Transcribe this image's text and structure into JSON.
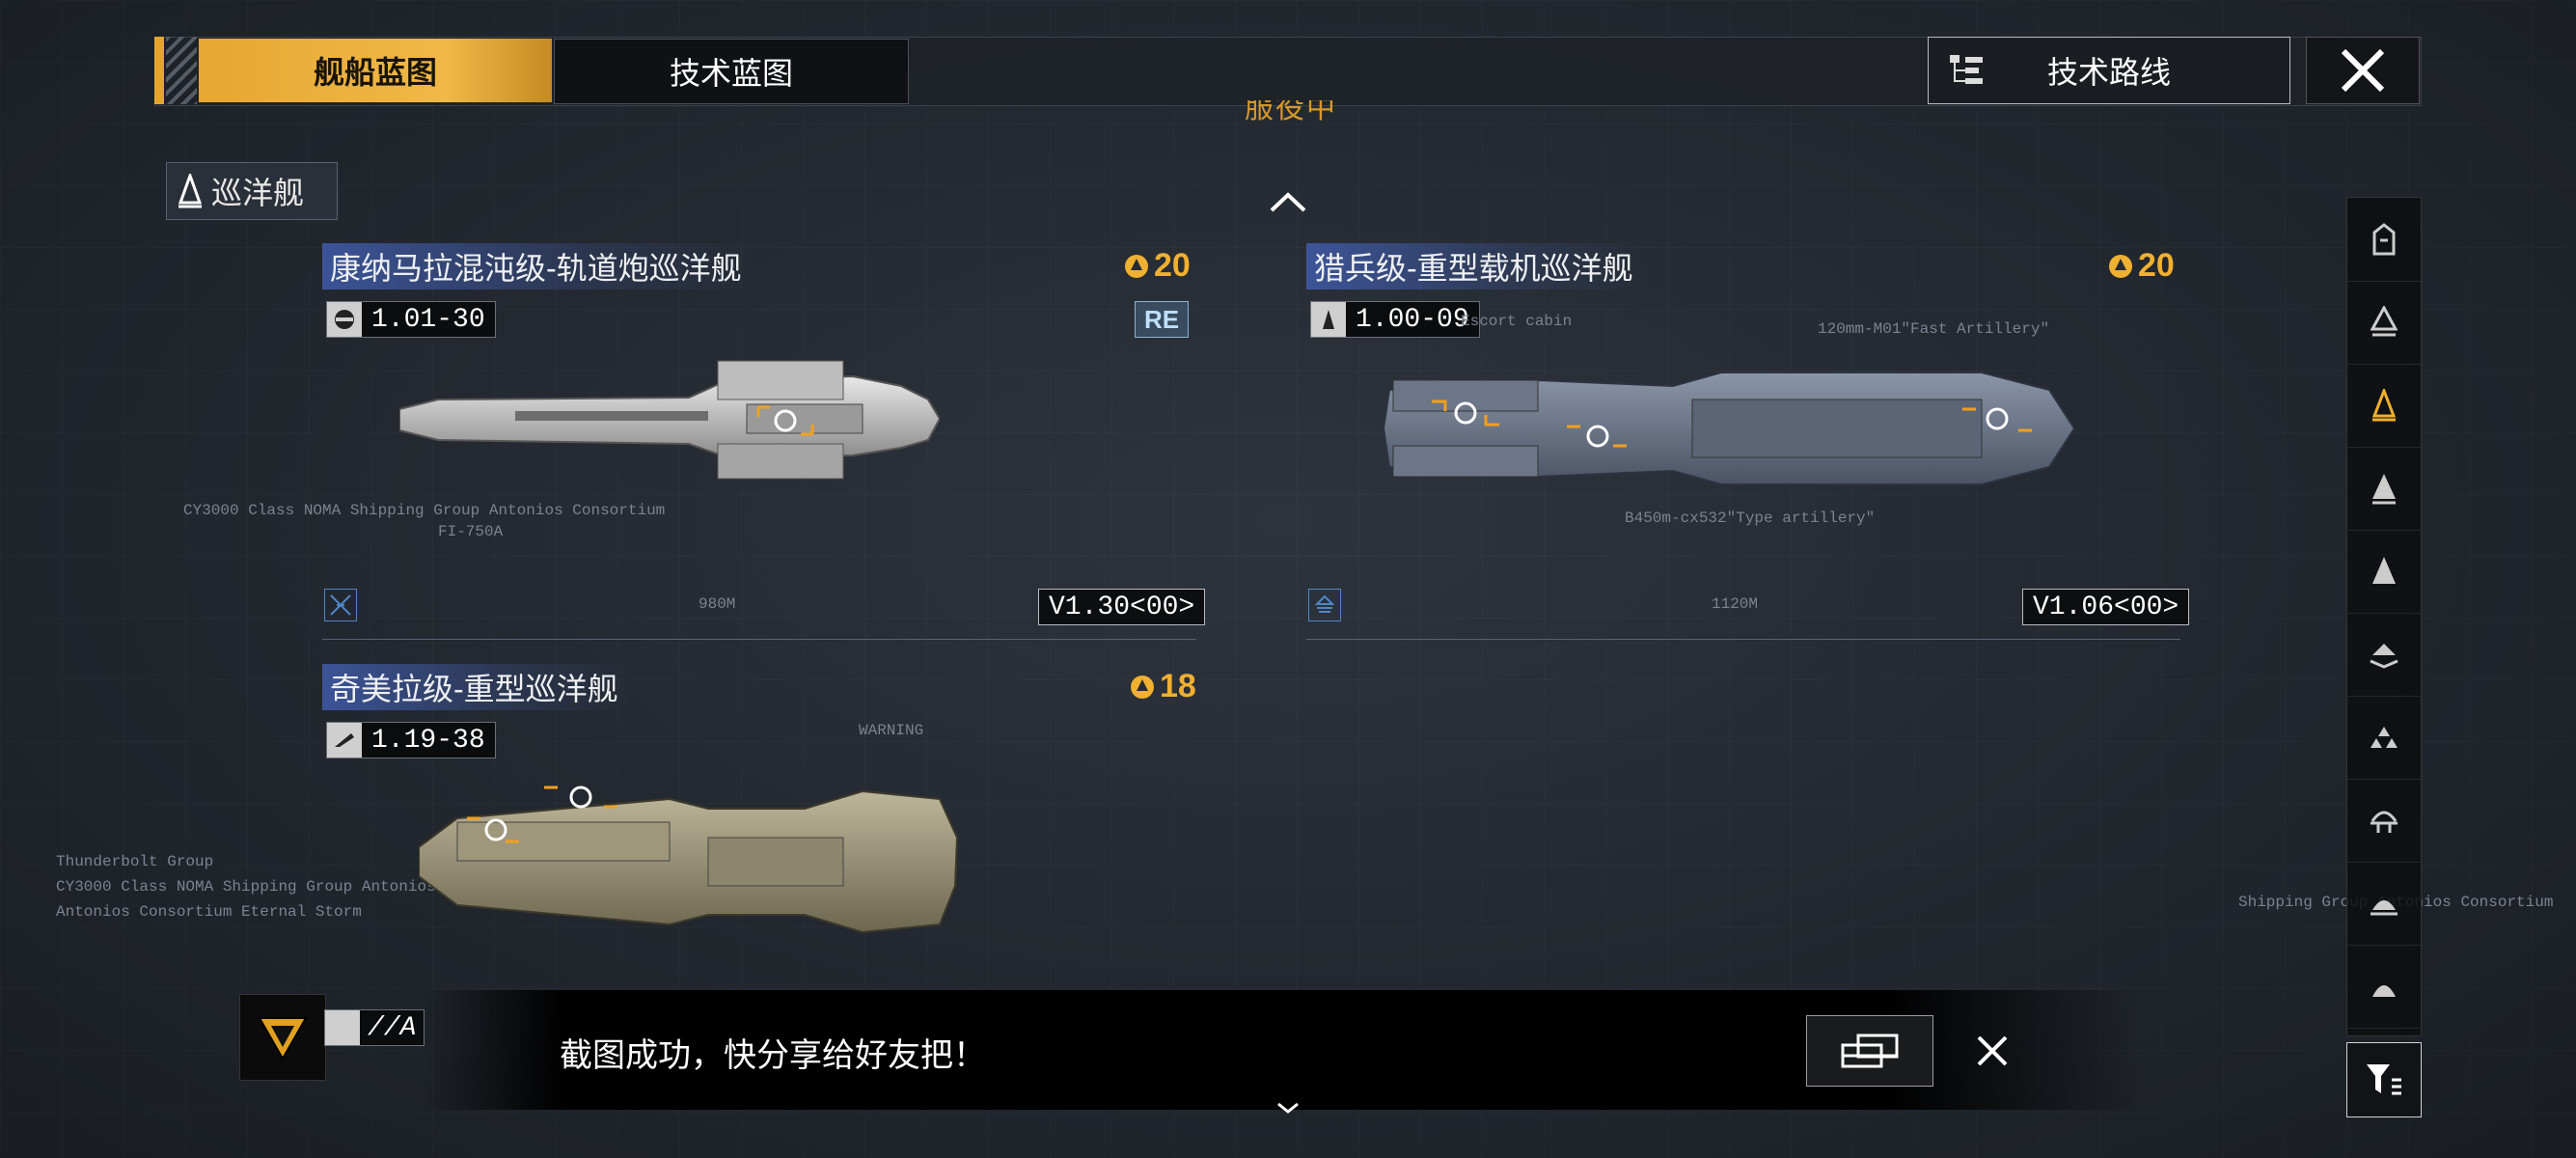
{
  "tabs": {
    "ship_blueprint": "舰船蓝图",
    "tech_blueprint": "技术蓝图"
  },
  "route_button": "技术路线",
  "subtitle": "服役中",
  "category": "巡洋舰",
  "ships": [
    {
      "title": "康纳马拉混沌级-轨道炮巡洋舰",
      "cost": "20",
      "version": "1.01-30",
      "badge": "RE",
      "build": "V1.30<00>",
      "icon": "gear-icon"
    },
    {
      "title": "猎兵级-重型载机巡洋舰",
      "cost": "20",
      "version": "1.00-09",
      "build": "V1.06<00>",
      "icon": "carrier-icon"
    },
    {
      "title": "奇美拉级-重型巡洋舰",
      "cost": "18",
      "version": "1.19-38",
      "icon": "cruiser-icon"
    }
  ],
  "partial_tag": "//A",
  "toast": {
    "message": "截图成功，快分享给好友把！"
  },
  "rail": [
    "frigate-icon",
    "destroyer-icon",
    "cruiser-icon",
    "battlecruiser-icon",
    "battleship-icon",
    "carrier-icon",
    "auxiliary-icon",
    "station-icon",
    "support-icon",
    "special-icon"
  ],
  "colors": {
    "accent": "#e7a731",
    "title_band": "#405caa",
    "cost": "#f0b030"
  }
}
